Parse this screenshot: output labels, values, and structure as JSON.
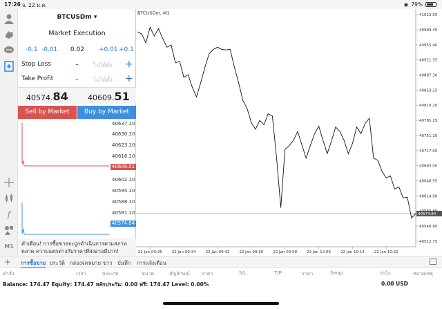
{
  "status": {
    "time": "17:26",
    "date": "จ. 22 ม.ค.",
    "battery_text": "79%",
    "battery_level": 0.79
  },
  "toolbar": {
    "items": [
      "user-icon",
      "hand-icon",
      "chat-icon",
      "new-order-icon",
      "crosshair-icon",
      "candles-icon",
      "function-icon",
      "objects-icon"
    ],
    "timeframe": "M1"
  },
  "order": {
    "symbol": "BTCUSDm",
    "execution": "Market Execution",
    "steps": [
      "-0.1",
      "-0.01",
      "0.02",
      "+0.01",
      "+0.1"
    ],
    "stop_loss_label": "Stop Loss",
    "take_profit_label": "Take Profit",
    "sl_placeholder": "ไม่ได้ตั้ง",
    "tp_placeholder": "ไม่ได้ตั้ง",
    "minus": "-",
    "plus": "+",
    "bid_main": "40574.",
    "bid_big": "84",
    "ask_main": "40609.",
    "ask_big": "51",
    "sell_label": "Sell by Market",
    "buy_label": "Buy by Market",
    "ask_levels": [
      "40637.10",
      "40630.10",
      "40623.10",
      "40616.10",
      "40609.51",
      "40602.10"
    ],
    "bid_levels": [
      "40595.10",
      "40588.10",
      "40581.10",
      "40574.84"
    ],
    "warning": "คำเตือน! การซื้อขายจะถูกดำเนินการตามสภาพตลาด ความแตกต่างกับราคาที่ส่งอาจมีมาก!",
    "colors": {
      "sell": "#d9534f",
      "buy": "#3d8fe0"
    }
  },
  "chart_data": {
    "type": "line",
    "title": "BTCUSDm, M1",
    "xlabel": "",
    "ylabel": "",
    "x_ticks": [
      "22 Jan 09:26",
      "22 Jan 09:34",
      "22 Jan 09:42",
      "22 Jan 09:50",
      "22 Jan 09:58",
      "22 Jan 10:06",
      "22 Jan 10:14",
      "22 Jan 10:22"
    ],
    "y_ticks": [
      "41023.50",
      "40989.45",
      "40955.40",
      "40921.35",
      "40887.30",
      "40853.25",
      "40819.20",
      "40785.15",
      "40751.10",
      "40717.05",
      "40683.00",
      "40648.95",
      "40614.90",
      "40580.85",
      "40546.80",
      "40512.75"
    ],
    "ylim": [
      40500,
      41030
    ],
    "current_price": "40574.84",
    "current_value": 40574.84,
    "grid": false,
    "x": [
      "09:23",
      "09:24",
      "09:25",
      "09:26",
      "09:27",
      "09:28",
      "09:29",
      "09:30",
      "09:31",
      "09:32",
      "09:33",
      "09:34",
      "09:35",
      "09:36",
      "09:37",
      "09:38",
      "09:39",
      "09:40",
      "09:41",
      "09:42",
      "09:43",
      "09:44",
      "09:45",
      "09:46",
      "09:47",
      "09:48",
      "09:49",
      "09:50",
      "09:51",
      "09:52",
      "09:53",
      "09:54",
      "09:55",
      "09:56",
      "09:57",
      "09:58",
      "09:59",
      "10:00",
      "10:01",
      "10:02",
      "10:03",
      "10:04",
      "10:05",
      "10:06",
      "10:07",
      "10:08",
      "10:09",
      "10:10",
      "10:11",
      "10:12",
      "10:13",
      "10:14",
      "10:15",
      "10:16",
      "10:17",
      "10:18",
      "10:19",
      "10:20",
      "10:21",
      "10:22",
      "10:23",
      "10:24",
      "10:25",
      "10:26",
      "10:27",
      "10:28",
      "10:29"
    ],
    "values": [
      40985,
      40980,
      40960,
      40995,
      40975,
      40992,
      40970,
      40950,
      40955,
      40915,
      40918,
      40882,
      40888,
      40860,
      40838,
      40870,
      40905,
      40935,
      40945,
      40950,
      40945,
      40944,
      40945,
      40905,
      40870,
      40830,
      40812,
      40780,
      40765,
      40785,
      40775,
      40800,
      40795,
      40700,
      40588,
      40720,
      40728,
      40740,
      40760,
      40730,
      40700,
      40728,
      40755,
      40772,
      40740,
      40710,
      40738,
      40770,
      40760,
      40740,
      40710,
      40733,
      40770,
      40755,
      40778,
      40790,
      40700,
      40695,
      40670,
      40655,
      40660,
      40630,
      40635,
      40610,
      40612,
      40565,
      40575
    ]
  },
  "tabs": {
    "plus": "+",
    "items": [
      "การซื้อขาย",
      "ประวัติ",
      "กล่องจดหมาย",
      "ข่าว",
      "บันทึก",
      "การแจ้งเตือน"
    ],
    "active": 0
  },
  "columns": [
    "คำสั่ง",
    "เวลา",
    "ประเภท",
    "ขนาด",
    "สัญลักษณ์",
    "ราคา",
    "S/L",
    "T/P",
    "ราคา",
    "Swap",
    "กำไร",
    "หมายเหตุ"
  ],
  "account": {
    "balance_line": "Balance: 174.47 Equity: 174.47 หลักประกัน: 0.00 ฟรี: 174.47 Level: 0.00%",
    "profit": "0.00 USD"
  }
}
